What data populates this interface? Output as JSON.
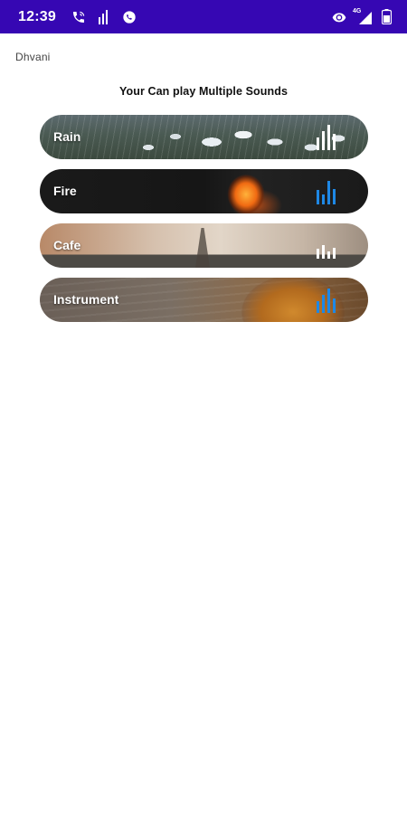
{
  "status_bar": {
    "time": "12:39",
    "left_icons": [
      "phone-wifi-icon",
      "signal-bars-icon",
      "whatsapp-icon"
    ],
    "right_icons": [
      "eye-icon",
      "network-4g-icon",
      "battery-icon"
    ],
    "network_label": "4G",
    "background_color": "#3607b3"
  },
  "app": {
    "title": "Dhvani",
    "subtitle": "Your Can play Multiple Sounds"
  },
  "sounds": [
    {
      "label": "Rain",
      "playing": false,
      "icon": "equalizer-icon",
      "icon_color": "#ffffff"
    },
    {
      "label": "Fire",
      "playing": true,
      "icon": "equalizer-icon",
      "icon_color": "#1e88e5"
    },
    {
      "label": "Cafe",
      "playing": false,
      "icon": "equalizer-icon",
      "icon_color": "#ffffff"
    },
    {
      "label": "Instrument",
      "playing": true,
      "icon": "equalizer-icon",
      "icon_color": "#1e88e5"
    }
  ]
}
